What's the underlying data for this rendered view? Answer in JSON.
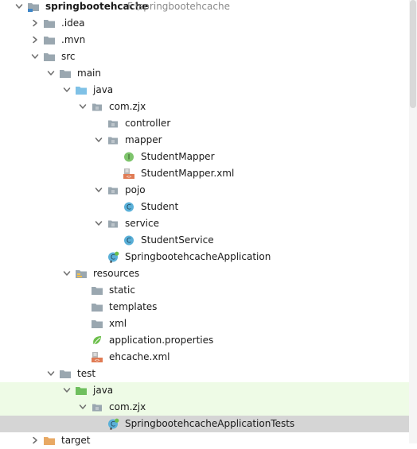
{
  "project": {
    "name": "springbootehcache",
    "path": "F:\\springbootehcache"
  },
  "colors": {
    "folder": "#9aa7b0",
    "folder_source": "#7fc1e6",
    "folder_test": "#6fbf5e",
    "folder_excluded": "#e8a964",
    "class_icon": "#5ab0d8",
    "interface_icon": "#7ec46c",
    "test_background": "#eefbe6",
    "selected_background": "#d5d5d5"
  },
  "tree": [
    {
      "label": "springbootehcache",
      "depth": 0,
      "expanded": true,
      "icon": "module-folder-icon",
      "bold": true,
      "hint": "F:\\springbootehcache"
    },
    {
      "label": ".idea",
      "depth": 1,
      "expanded": false,
      "icon": "folder-icon"
    },
    {
      "label": ".mvn",
      "depth": 1,
      "expanded": false,
      "icon": "folder-icon"
    },
    {
      "label": "src",
      "depth": 1,
      "expanded": true,
      "icon": "folder-icon"
    },
    {
      "label": "main",
      "depth": 2,
      "expanded": true,
      "icon": "folder-icon"
    },
    {
      "label": "java",
      "depth": 3,
      "expanded": true,
      "icon": "source-folder-icon"
    },
    {
      "label": "com.zjx",
      "depth": 4,
      "expanded": true,
      "icon": "package-icon"
    },
    {
      "label": "controller",
      "depth": 5,
      "icon": "package-icon"
    },
    {
      "label": "mapper",
      "depth": 5,
      "expanded": true,
      "icon": "package-icon"
    },
    {
      "label": "StudentMapper",
      "depth": 6,
      "icon": "interface-icon"
    },
    {
      "label": "StudentMapper.xml",
      "depth": 6,
      "icon": "xml-file-icon"
    },
    {
      "label": "pojo",
      "depth": 5,
      "expanded": true,
      "icon": "package-icon"
    },
    {
      "label": "Student",
      "depth": 6,
      "icon": "class-icon"
    },
    {
      "label": "service",
      "depth": 5,
      "expanded": true,
      "icon": "package-icon"
    },
    {
      "label": "StudentService",
      "depth": 6,
      "icon": "class-icon"
    },
    {
      "label": "SpringbootehcacheApplication",
      "depth": 5,
      "icon": "spring-boot-class-icon"
    },
    {
      "label": "resources",
      "depth": 3,
      "expanded": true,
      "icon": "resources-folder-icon"
    },
    {
      "label": "static",
      "depth": 4,
      "icon": "folder-icon"
    },
    {
      "label": "templates",
      "depth": 4,
      "icon": "folder-icon"
    },
    {
      "label": "xml",
      "depth": 4,
      "icon": "folder-icon"
    },
    {
      "label": "application.properties",
      "depth": 4,
      "icon": "spring-properties-icon"
    },
    {
      "label": "ehcache.xml",
      "depth": 4,
      "icon": "xml-file-icon"
    },
    {
      "label": "test",
      "depth": 2,
      "expanded": true,
      "icon": "folder-icon"
    },
    {
      "label": "java",
      "depth": 3,
      "expanded": true,
      "icon": "test-source-folder-icon",
      "test_bg": true
    },
    {
      "label": "com.zjx",
      "depth": 4,
      "expanded": true,
      "icon": "package-icon",
      "test_bg": true
    },
    {
      "label": "SpringbootehcacheApplicationTests",
      "depth": 5,
      "icon": "spring-boot-class-icon",
      "selected": true
    },
    {
      "label": "target",
      "depth": 1,
      "expanded": false,
      "icon": "excluded-folder-icon"
    }
  ]
}
